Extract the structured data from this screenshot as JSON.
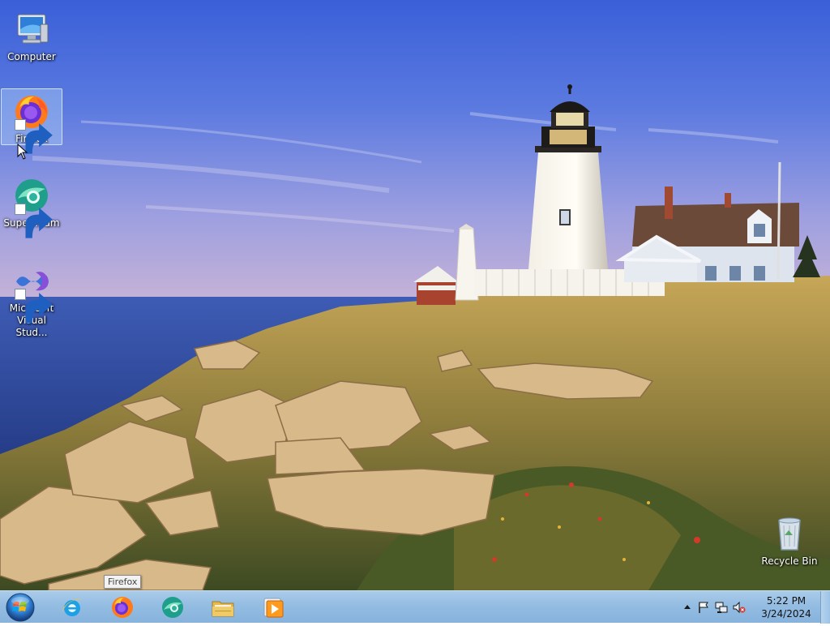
{
  "desktop": {
    "icons": [
      {
        "label": "Computer",
        "icon": "computer-icon",
        "shortcut": false
      },
      {
        "label": "Firefox",
        "icon": "firefox-icon",
        "shortcut": true,
        "selected": true
      },
      {
        "label": "Supermium",
        "icon": "supermium-icon",
        "shortcut": true
      },
      {
        "label": "Microsoft Visual Stud...",
        "icon": "visual-studio-icon",
        "shortcut": true
      },
      {
        "label": "Recycle Bin",
        "icon": "recycle-bin-icon",
        "shortcut": false
      }
    ],
    "tooltip": "Firefox"
  },
  "taskbar": {
    "start_icon": "windows-start-orb",
    "pinned": [
      {
        "name": "Internet Explorer",
        "icon": "internet-explorer-icon"
      },
      {
        "name": "Firefox",
        "icon": "firefox-icon"
      },
      {
        "name": "Supermium",
        "icon": "supermium-icon"
      },
      {
        "name": "Windows Explorer",
        "icon": "folder-icon"
      },
      {
        "name": "Windows Media Player",
        "icon": "media-player-icon"
      }
    ],
    "tray": {
      "icons": [
        "show-hidden-icons-arrow",
        "action-center-flag-icon",
        "network-icon",
        "volume-muted-icon"
      ],
      "time": "5:22 PM",
      "date": "3/24/2024"
    }
  },
  "colors": {
    "taskbar": "#94bde2",
    "sky_top": "#3f63d6",
    "sea": "#2f4d9a",
    "grass": "#b89a4e"
  }
}
